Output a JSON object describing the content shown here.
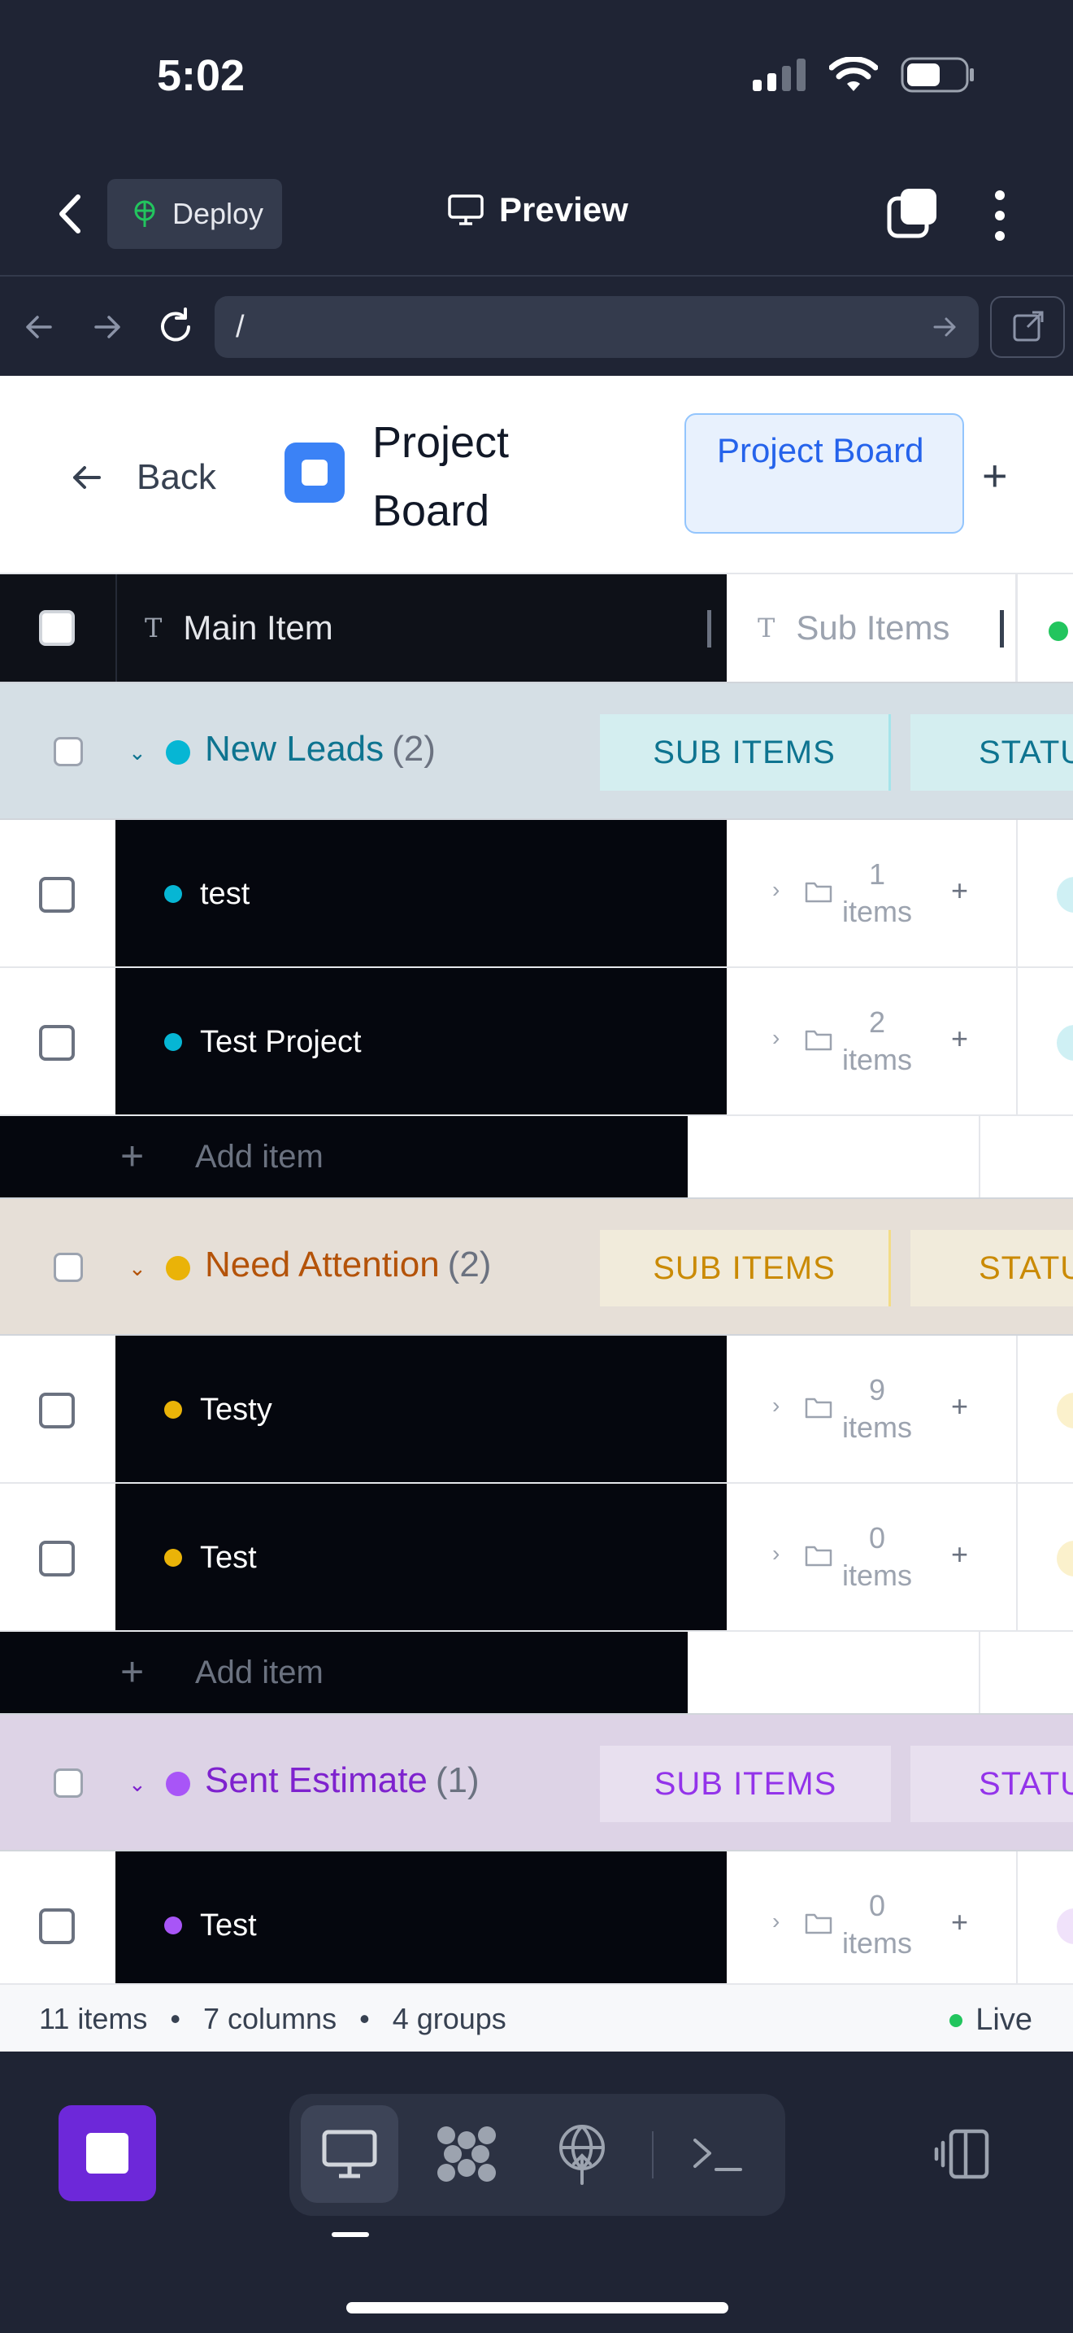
{
  "status_bar": {
    "time": "5:02"
  },
  "app_bar": {
    "deploy_label": "Deploy",
    "preview_label": "Preview"
  },
  "url_bar": {
    "url": "/"
  },
  "page_header": {
    "back_label": "Back",
    "board_title": "Project Board",
    "tab_label": "Project Board"
  },
  "table": {
    "columns": [
      {
        "label": "Main Item"
      },
      {
        "label": "Sub Items"
      }
    ],
    "groups": [
      {
        "name": "New Leads",
        "count": "(2)",
        "color": "#06b6d4",
        "bg": "#d5dfe5",
        "text_color": "#0e7490",
        "pill_bg": "#d4eef0",
        "pill1": "SUB ITEMS",
        "pill2": "STATUS",
        "items": [
          {
            "name": "test",
            "sub_count": "1",
            "sub_unit": "items"
          },
          {
            "name": "Test Project",
            "sub_count": "2",
            "sub_unit": "items"
          }
        ],
        "add_label": "Add item"
      },
      {
        "name": "Need Attention",
        "count": "(2)",
        "color": "#eab308",
        "bg": "#e6dfd7",
        "text_color": "#b45309",
        "pill_bg": "#f1ebdb",
        "pill1": "SUB ITEMS",
        "pill2": "STATUS",
        "items": [
          {
            "name": "Testy",
            "sub_count": "9",
            "sub_unit": "items"
          },
          {
            "name": "Test",
            "sub_count": "0",
            "sub_unit": "items"
          }
        ],
        "add_label": "Add item"
      },
      {
        "name": "Sent Estimate",
        "count": "(1)",
        "color": "#a855f7",
        "bg": "#ddd3e6",
        "text_color": "#7e22ce",
        "pill_bg": "#e8e0ef",
        "pill1": "SUB ITEMS",
        "pill2": "STATUS",
        "items": [
          {
            "name": "Test",
            "sub_count": "0",
            "sub_unit": "items"
          }
        ]
      }
    ]
  },
  "footer": {
    "items": "11 items",
    "columns": "7 columns",
    "groups": "4 groups",
    "live": "Live"
  }
}
